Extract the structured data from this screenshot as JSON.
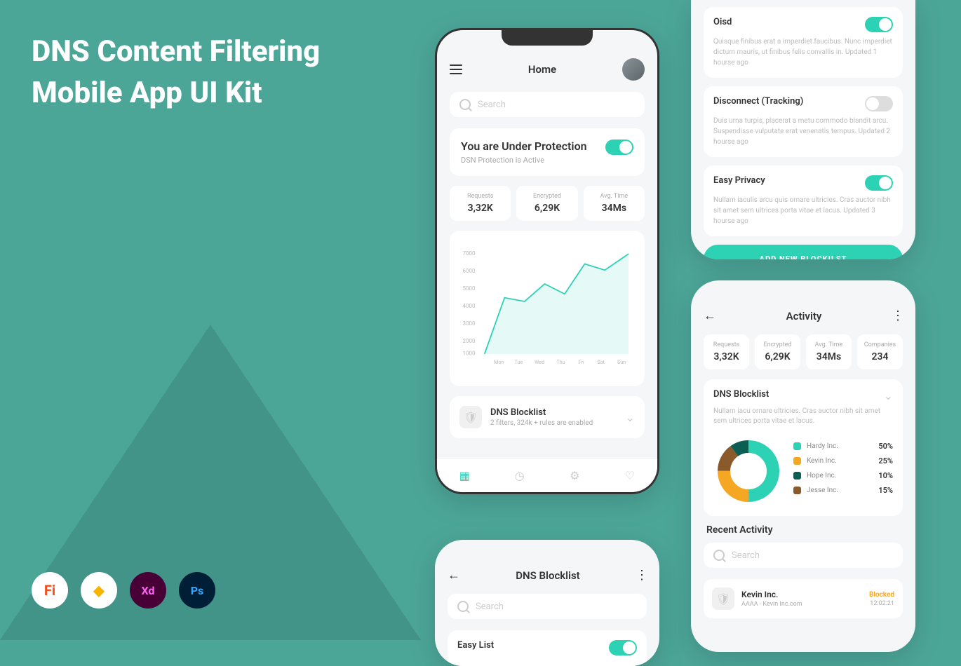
{
  "title_line1": "DNS Content Filtering",
  "title_line2": "Mobile App UI Kit",
  "tools": [
    "Fi",
    "◆",
    "Xd",
    "Ps"
  ],
  "home": {
    "header_title": "Home",
    "search_placeholder": "Search",
    "protection_title": "You are Under Protection",
    "protection_sub": "DSN Protection is Active",
    "stats": [
      {
        "label": "Requests",
        "value": "3,32K"
      },
      {
        "label": "Encrypted",
        "value": "6,29K"
      },
      {
        "label": "Avg. Time",
        "value": "34Ms"
      }
    ],
    "blocklist_title": "DNS Blocklist",
    "blocklist_sub": "2 filters, 324k + rules are enabled"
  },
  "chart_data": {
    "type": "line",
    "xlabel": "",
    "ylabel": "",
    "ylim": [
      1000,
      7000
    ],
    "categories": [
      "Mon",
      "Tue",
      "Wed",
      "Thu",
      "Fri",
      "Sat",
      "Sun"
    ],
    "values": [
      1000,
      4200,
      4000,
      5000,
      4400,
      6200,
      5800,
      7000
    ]
  },
  "blocklists": {
    "items": [
      {
        "name": "Oisd",
        "desc": "Quisque finibus erat a imperdiet faucibus. Nunc imperdiet dictum mauris, ut finibus felis convallis in. Updated 1 hourse ago",
        "on": true
      },
      {
        "name": "Disconnect (Tracking)",
        "desc": "Duis urna turpis, placerat a metu commodo blandit arcu. Suspendisse vulputate erat venenatis tempus. Updated 2 hourse ago",
        "on": false
      },
      {
        "name": "Easy Privacy",
        "desc": "Nullam iaculis arcu quis ornare ultricies. Cras auctor nibh sit amet sem ultrices porta vitae et lacus. Updated 3 hourse ago",
        "on": true
      }
    ],
    "add_btn": "ADD NEW BLOCKILST"
  },
  "activity": {
    "header_title": "Activity",
    "stats": [
      {
        "label": "Requests",
        "value": "3,32K"
      },
      {
        "label": "Encrypted",
        "value": "6,29K"
      },
      {
        "label": "Avg. Time",
        "value": "34Ms"
      },
      {
        "label": "Companies",
        "value": "234"
      }
    ],
    "blocklist_title": "DNS Blocklist",
    "blocklist_desc": "Nullam iacu ornare ultricies. Cras auctor nibh sit amet sem ultrices porta vitae et lacus.",
    "donut": [
      {
        "name": "Hardy Inc.",
        "value": "50%",
        "color": "#2dd1b3"
      },
      {
        "name": "Kevin Inc.",
        "value": "25%",
        "color": "#f5a623"
      },
      {
        "name": "Hope Inc.",
        "value": "10%",
        "color": "#0d5e52"
      },
      {
        "name": "Jesse Inc.",
        "value": "15%",
        "color": "#8b5a2b"
      }
    ],
    "recent_title": "Recent Activity",
    "search_placeholder": "Search",
    "recent": {
      "name": "Kevin Inc.",
      "sub": "AAAA - Kevin Inc.com",
      "status": "Blocked",
      "time": "12:02:21"
    }
  },
  "blocklist_screen": {
    "header_title": "DNS Blocklist",
    "search_placeholder": "Search",
    "easy_list": "Easy List"
  }
}
